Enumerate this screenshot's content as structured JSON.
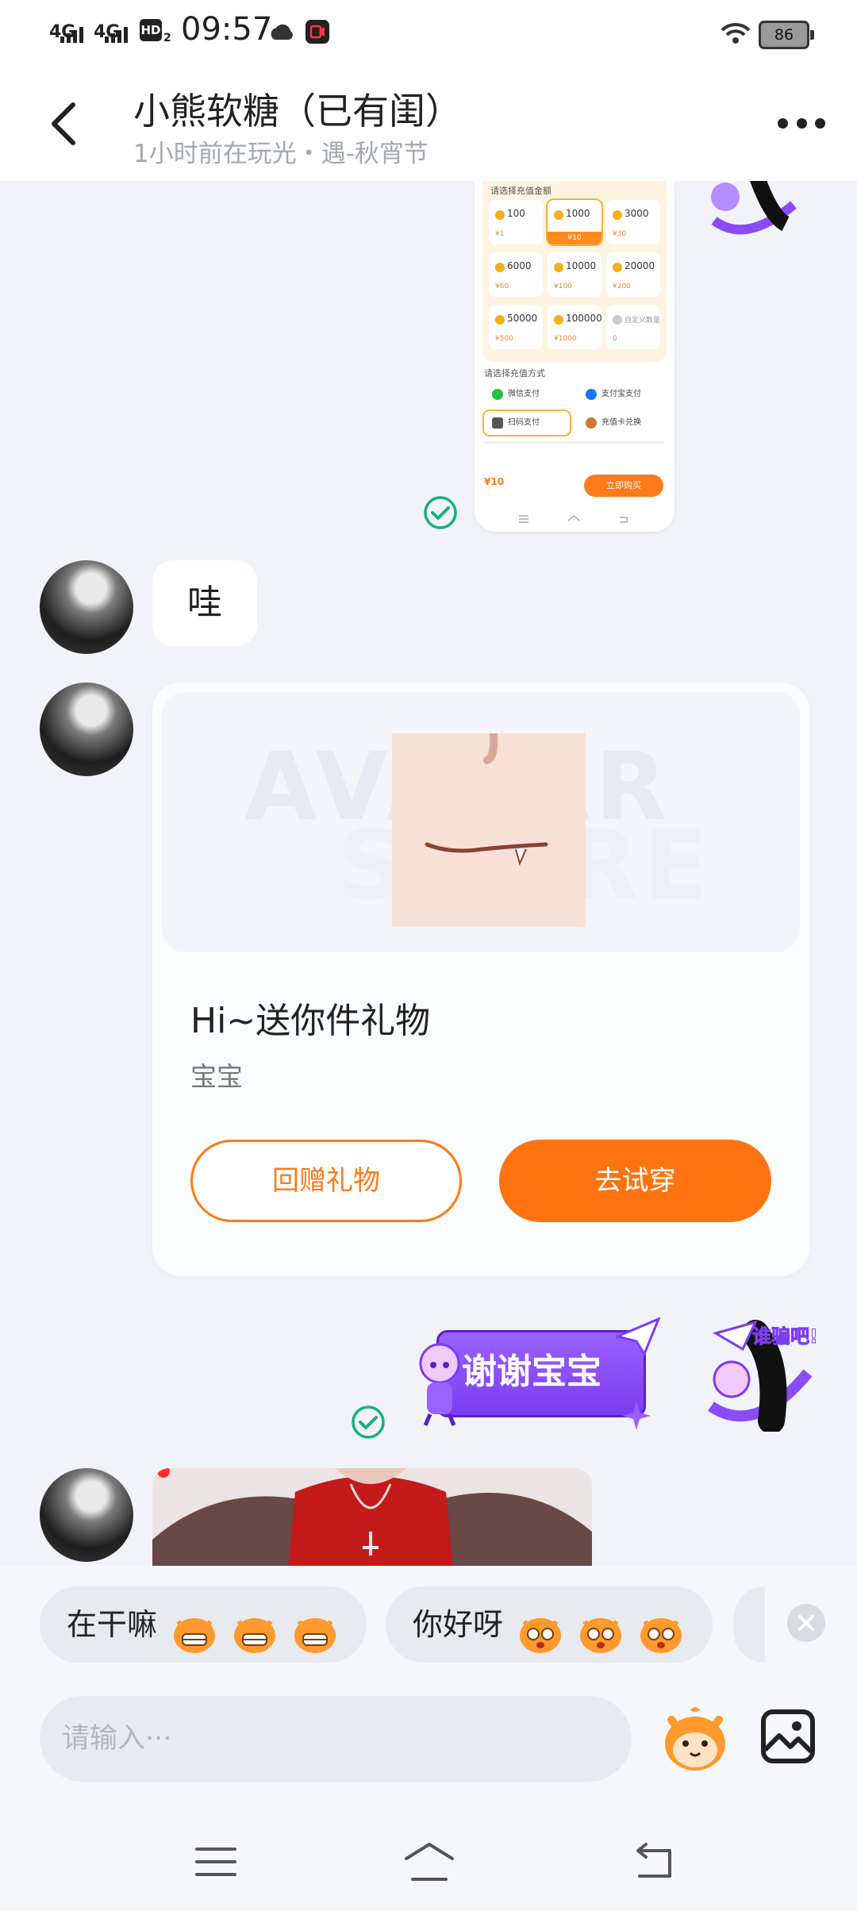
{
  "status_bar": {
    "signal_1": "4G",
    "signal_2": "4G",
    "hd_badge": "HD",
    "hd_sub": "2",
    "time": "09:57",
    "battery": "86"
  },
  "header": {
    "title": "小熊软糖（已有闺）",
    "subtitle": "1小时前在玩光・遇-秋宵节"
  },
  "recharge_screenshot": {
    "section_amount": "请选择充值金额",
    "coins": [
      {
        "amount": "100",
        "price": "¥1"
      },
      {
        "amount": "1000",
        "price": "¥10"
      },
      {
        "amount": "3000",
        "price": "¥30"
      },
      {
        "amount": "6000",
        "price": "¥60"
      },
      {
        "amount": "10000",
        "price": "¥100"
      },
      {
        "amount": "20000",
        "price": "¥200"
      },
      {
        "amount": "50000",
        "price": "¥500"
      },
      {
        "amount": "100000",
        "price": "¥1000"
      },
      {
        "amount": "自定义数量",
        "price": "0"
      }
    ],
    "section_payment": "请选择充值方式",
    "payments": [
      "微信支付",
      "支付宝支付",
      "扫码支付",
      "充值卡兑换"
    ],
    "price": "¥10",
    "buy_label": "立即购买"
  },
  "messages": {
    "text_1": "哇",
    "gift_card": {
      "title": "Hi~送你件礼物",
      "subtitle": "宝宝",
      "watermark_1": "AVATAR",
      "watermark_2": "STORE",
      "return_gift": "回赠礼物",
      "try_on": "去试穿"
    },
    "sticker_text": "谢谢宝宝",
    "sticker_avatar_text": "谁骗吧!"
  },
  "quick_replies": [
    {
      "text": "在干嘛"
    },
    {
      "text": "你好呀"
    }
  ],
  "input": {
    "placeholder": "请输入···"
  },
  "colors": {
    "accent": "#ff7411",
    "check": "#18b07a",
    "sticker_purple": "#8a4cf6"
  }
}
